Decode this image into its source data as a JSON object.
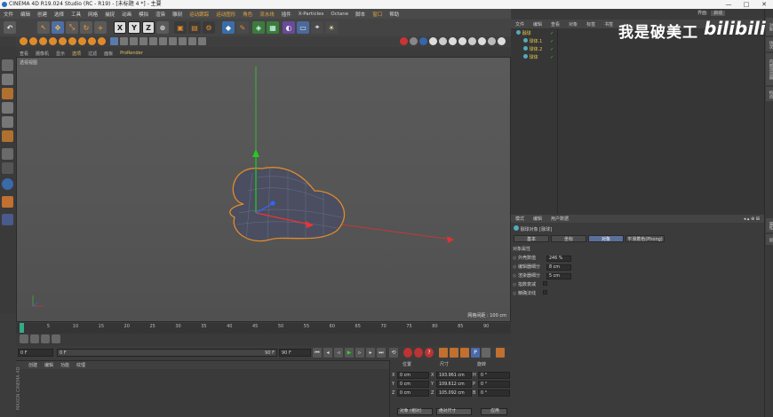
{
  "window": {
    "title": "CINEMA 4D R19.024 Studio (RC - R19) - [未标题 4 *] - 主要",
    "controls": [
      "—",
      "□",
      "✕"
    ],
    "layout_label": "界面:",
    "layout_value": "启动"
  },
  "menubar": {
    "items": [
      "文件",
      "编辑",
      "创建",
      "选择",
      "工具",
      "网格",
      "捕捉",
      "动画",
      "模拟",
      "渲染",
      "雕刻",
      "运动跟踪",
      "运动图形",
      "角色",
      "流水线",
      "插件",
      "X-Particles",
      "Octane",
      "脚本",
      "窗口",
      "帮助"
    ]
  },
  "main_toolbar": {
    "axis_x": "X",
    "axis_y": "Y",
    "axis_z": "Z"
  },
  "viewport": {
    "menu": [
      "查看",
      "摄像机",
      "显示",
      "选项",
      "过滤",
      "面板",
      "ProRender"
    ],
    "label": "透视视图",
    "grid_spacing": "网格间距 : 100 cm"
  },
  "timeline": {
    "ticks": [
      "0",
      "5",
      "10",
      "15",
      "20",
      "25",
      "30",
      "35",
      "40",
      "45",
      "50",
      "55",
      "60",
      "65",
      "70",
      "75",
      "80",
      "85",
      "90"
    ],
    "current_frame": "0 F"
  },
  "playback": {
    "start": "0 F",
    "start2": "0 F",
    "end": "90 F",
    "end2": "90 F"
  },
  "material_manager": {
    "menu": [
      "创建",
      "编辑",
      "功能",
      "纹理"
    ],
    "brand": "MAXON CINEMA 4D"
  },
  "coordinates": {
    "headers": [
      "位置",
      "尺寸",
      "旋转"
    ],
    "rows": [
      {
        "axis": "X",
        "pos": "0 cm",
        "size": "193.961 cm",
        "rot_label": "H",
        "rot": "0 °"
      },
      {
        "axis": "Y",
        "pos": "0 cm",
        "size": "109.612 cm",
        "rot_label": "P",
        "rot": "0 °"
      },
      {
        "axis": "Z",
        "pos": "0 cm",
        "size": "105.092 cm",
        "rot_label": "B",
        "rot": "0 °"
      }
    ],
    "mode_select": "对象 (相对)",
    "size_select": "绝对尺寸",
    "apply": "应用"
  },
  "object_manager": {
    "menu": [
      "文件",
      "编辑",
      "查看",
      "对象",
      "标签",
      "书签"
    ],
    "objects": [
      {
        "name": "融球",
        "color": "#e8c94a"
      },
      {
        "name": "球体.1",
        "color": "#d0d0d0"
      },
      {
        "name": "球体.2",
        "color": "#d0d0d0"
      },
      {
        "name": "球体",
        "color": "#d0d0d0"
      }
    ]
  },
  "attributes": {
    "menu": [
      "模式",
      "编辑",
      "用户数据"
    ],
    "title": "融球对象 [融球]",
    "tabs": [
      "基本",
      "坐标",
      "对象",
      "平滑着色(Phong)"
    ],
    "active_tab": "对象",
    "section": "对象属性",
    "fields": [
      {
        "label": "外壳数值",
        "value": "246 %"
      },
      {
        "label": "编辑器细分",
        "value": "8 cm"
      },
      {
        "label": "渲染器细分",
        "value": "5 cm"
      },
      {
        "label": "指数衰减",
        "value": ""
      },
      {
        "label": "精确法线",
        "value": ""
      }
    ]
  },
  "right_tabs": [
    "对象",
    "场次",
    "内容浏览器",
    "构造",
    "属性",
    "层"
  ],
  "watermark": {
    "text": "我是破美工",
    "logo": "bilibili"
  },
  "colors": {
    "accent_orange": "#e08b2b",
    "active_tab": "#5a6f9a",
    "axis_x": "#d33",
    "axis_y": "#3c3",
    "axis_z": "#36f"
  }
}
